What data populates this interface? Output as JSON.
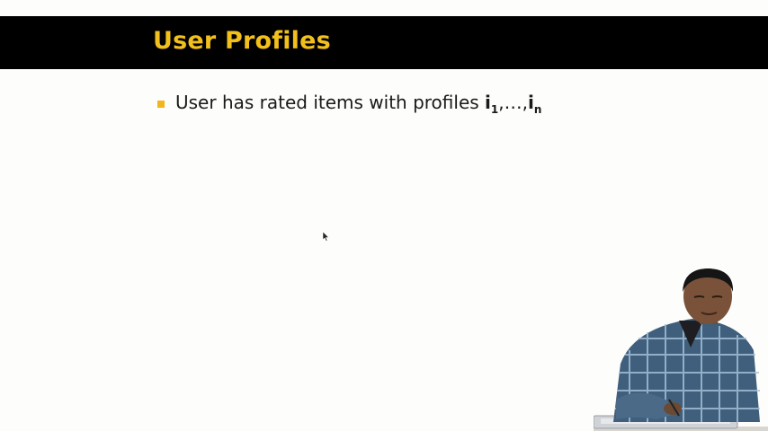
{
  "slide": {
    "title": "User Profiles",
    "bullet": {
      "text": "User has rated items with profiles ",
      "var1": "i",
      "sub1": "1",
      "sep": ",…,",
      "var2": "i",
      "sub2": "n"
    }
  },
  "colors": {
    "title_bar": "#000000",
    "title_text": "#f2c01c",
    "bullet_marker": "#f2b51c"
  },
  "icons": {
    "cursor": "mouse-pointer-icon"
  }
}
